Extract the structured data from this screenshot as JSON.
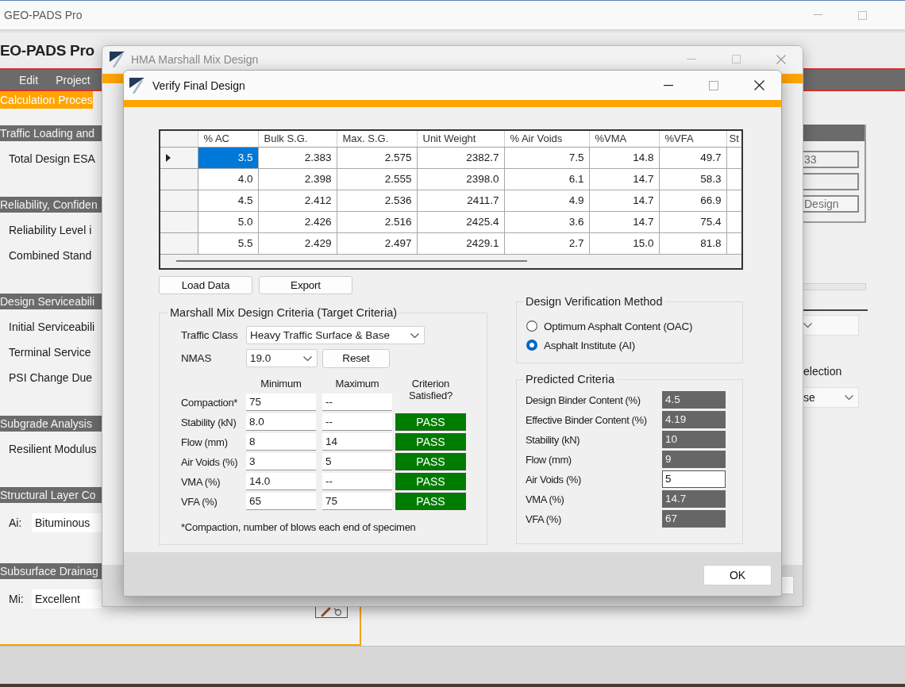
{
  "main_window": {
    "title": "GEO-PADS Pro",
    "app_name": "EO-PADS Pro",
    "menu": [
      {
        "label": "Edit"
      },
      {
        "label": "Project"
      }
    ],
    "tabs": [
      {
        "label": "Calculation Proces",
        "selected": true
      }
    ],
    "sections": [
      {
        "title": "Traffic Loading and",
        "rows": [
          {
            "kind": "label",
            "label": "Total Design ESA"
          }
        ]
      },
      {
        "title": "Reliability, Confiden",
        "rows": [
          {
            "kind": "label",
            "label": "Reliability Level i"
          },
          {
            "kind": "label",
            "label": "Combined Stand"
          }
        ]
      },
      {
        "title": "Design Serviceabili",
        "rows": [
          {
            "kind": "label",
            "label": "Initial Serviceabili"
          },
          {
            "kind": "label",
            "label": "Terminal Service"
          },
          {
            "kind": "label",
            "label": "PSI Change Due"
          }
        ]
      },
      {
        "title": "Subgrade Analysis",
        "rows": [
          {
            "kind": "label",
            "label": "Resilient Modulus"
          }
        ]
      },
      {
        "title": "Structural Layer Co",
        "rows": [
          {
            "kind": "field",
            "label": "Ai:",
            "value": "Bituminous"
          }
        ]
      },
      {
        "title": "Subsurface Drainag",
        "rows": [
          {
            "kind": "field",
            "label": "Mi:",
            "value": "Excellent"
          }
        ]
      }
    ],
    "right_panel": {
      "group": [
        {
          "kind": "field",
          "value": "33"
        },
        {
          "kind": "field"
        },
        {
          "kind": "button",
          "label": "Design"
        }
      ],
      "controls": [
        {
          "kind": "bar"
        },
        {
          "kind": "dropdown"
        },
        {
          "kind": "label",
          "text": "election"
        },
        {
          "kind": "dropdown",
          "value": "se"
        }
      ]
    }
  },
  "back_dialog": {
    "title": "HMA Marshall Mix Design",
    "active": false
  },
  "dialog": {
    "title": "Verify Final Design",
    "table": {
      "columns": [
        "% AC",
        "Bulk S.G.",
        "Max. S.G.",
        "Unit Weight",
        "% Air Voids",
        "%VMA",
        "%VFA",
        "St"
      ],
      "rows": [
        {
          "selected": true,
          "cells": [
            "3.5",
            "2.383",
            "2.575",
            "2382.7",
            "7.5",
            "14.8",
            "49.7"
          ]
        },
        {
          "selected": false,
          "cells": [
            "4.0",
            "2.398",
            "2.555",
            "2398.0",
            "6.1",
            "14.7",
            "58.3"
          ]
        },
        {
          "selected": false,
          "cells": [
            "4.5",
            "2.412",
            "2.536",
            "2411.7",
            "4.9",
            "14.7",
            "66.9"
          ]
        },
        {
          "selected": false,
          "cells": [
            "5.0",
            "2.426",
            "2.516",
            "2425.4",
            "3.6",
            "14.7",
            "75.4"
          ]
        },
        {
          "selected": false,
          "cells": [
            "5.5",
            "2.429",
            "2.497",
            "2429.1",
            "2.7",
            "15.0",
            "81.8"
          ]
        }
      ]
    },
    "buttons": [
      {
        "label": "Load Data"
      },
      {
        "label": "Export"
      }
    ],
    "criteria": {
      "title": "Marshall Mix Design Criteria (Target Criteria)",
      "traffic_class": {
        "label": "Traffic Class",
        "value": "Heavy Traffic Surface & Base"
      },
      "nmas": {
        "label": "NMAS",
        "value": "19.0"
      },
      "reset_button": "Reset",
      "headings": {
        "minimum": "Minimum",
        "maximum": "Maximum",
        "result": "Criterion Satisfied?"
      },
      "rows": [
        {
          "label": "Compaction*",
          "min": "75",
          "max": "--"
        },
        {
          "label": "Stability (kN)",
          "min": "8.0",
          "max": "--",
          "result": "PASS",
          "satisfied": true
        },
        {
          "label": "Flow (mm)",
          "min": "8",
          "max": "14",
          "result": "PASS",
          "satisfied": true
        },
        {
          "label": "Air Voids (%)",
          "min": "3",
          "max": "5",
          "result": "PASS",
          "satisfied": true
        },
        {
          "label": "VMA (%)",
          "min": "14.0",
          "max": "--",
          "result": "PASS",
          "satisfied": true
        },
        {
          "label": "VFA (%)",
          "min": "65",
          "max": "75",
          "result": "PASS",
          "satisfied": true
        }
      ],
      "note": "*Compaction, number of blows each end of specimen"
    },
    "verification_method": {
      "title": "Design Verification Method",
      "options": [
        {
          "label": "Optimum Asphalt Content (OAC)",
          "selected": false
        },
        {
          "label": "Asphalt Institute (AI)",
          "selected": true
        }
      ]
    },
    "predicted": {
      "title": "Predicted Criteria",
      "items": [
        {
          "label": "Design Binder Content (%)",
          "value": "4.5",
          "kind": "output"
        },
        {
          "label": "Effective Binder Content (%)",
          "value": "4.19",
          "kind": "output"
        },
        {
          "label": "Stability (kN)",
          "value": "10",
          "kind": "output"
        },
        {
          "label": "Flow (mm)",
          "value": "9",
          "kind": "output"
        },
        {
          "label": "Air Voids (%)",
          "value": "5",
          "kind": "input"
        },
        {
          "label": "VMA (%)",
          "value": "14.7",
          "kind": "output"
        },
        {
          "label": "VFA (%)",
          "value": "67",
          "kind": "output"
        }
      ]
    },
    "ok_button": "OK"
  }
}
